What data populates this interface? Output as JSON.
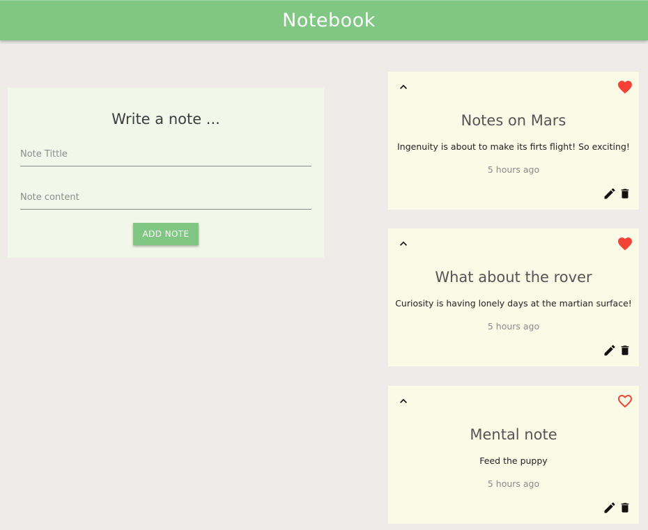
{
  "app": {
    "title": "Notebook"
  },
  "form": {
    "heading": "Write a note ...",
    "title_placeholder": "Note Tittle",
    "content_placeholder": "Note content",
    "add_label": "ADD NOTE"
  },
  "notes": [
    {
      "title": "Notes on Mars",
      "content": "Ingenuity is about to make its firts flight! So exciting!",
      "time": "5 hours ago",
      "favorite": true
    },
    {
      "title": "What about the rover",
      "content": "Curiosity is having lonely days at the martian surface!",
      "time": "5 hours ago",
      "favorite": true
    },
    {
      "title": "Mental note",
      "content": "Feed the puppy",
      "time": "5 hours ago",
      "favorite": false
    }
  ],
  "colors": {
    "header": "#81c784",
    "background": "#efebe9",
    "form_card": "#f1f8e9",
    "note_card": "#f9fbe7",
    "favorite": "#f44336"
  },
  "icons": {
    "collapse": "chevron-up-icon",
    "favorite_filled": "heart-filled-icon",
    "favorite_outline": "heart-outline-icon",
    "edit": "pencil-icon",
    "delete": "trash-icon"
  }
}
